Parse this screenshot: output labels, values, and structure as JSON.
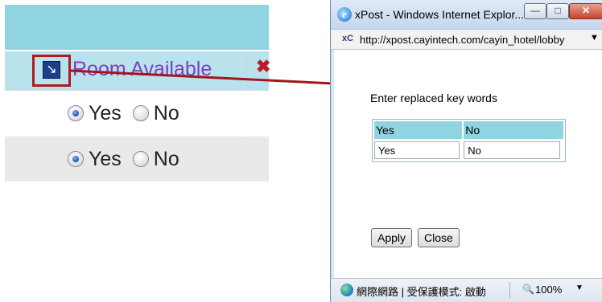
{
  "left": {
    "room_label": "Room Available",
    "rows": [
      {
        "yes_label": "Yes",
        "no_label": "No",
        "selected": "Yes"
      },
      {
        "yes_label": "Yes",
        "no_label": "No",
        "selected": "Yes"
      }
    ],
    "expand_icon": "expand-arrow-icon",
    "delete_icon": "red-x-icon",
    "colors": {
      "header": "#8fd4e0",
      "title_row": "#b8e3ec",
      "label": "#7f3fbf",
      "highlight": "#b0191e"
    }
  },
  "popup": {
    "window_title": "xPost - Windows Internet Explor...",
    "address_url": "http://xpost.cayintech.com/cayin_hotel/lobby",
    "prompt": "Enter replaced key words",
    "table": {
      "headers": [
        "Yes",
        "No"
      ],
      "values": [
        "Yes",
        "No"
      ]
    },
    "apply_label": "Apply",
    "close_label": "Close",
    "status_text": "網際網路 | 受保護模式: 啟動",
    "zoom": "100%"
  }
}
